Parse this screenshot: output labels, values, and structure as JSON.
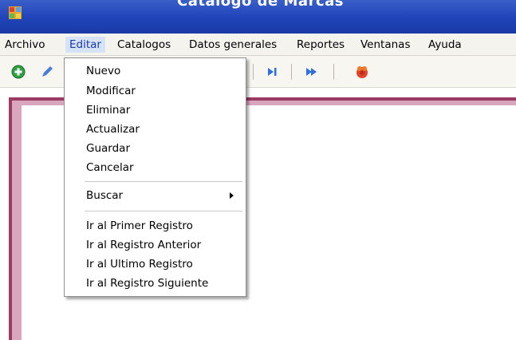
{
  "window": {
    "title": "Catalogo de Marcas"
  },
  "menubar": {
    "items": [
      {
        "label": "Archivo"
      },
      {
        "label": "Editar"
      },
      {
        "label": "Catalogos"
      },
      {
        "label": "Datos generales"
      },
      {
        "label": "Reportes"
      },
      {
        "label": "Ventanas"
      },
      {
        "label": "Ayuda"
      }
    ]
  },
  "toolbar": {
    "buttons": [
      {
        "icon": "add-icon"
      },
      {
        "icon": "edit-icon"
      },
      {
        "icon": "last-record-icon"
      },
      {
        "icon": "next-record-icon"
      },
      {
        "icon": "exit-icon"
      }
    ]
  },
  "dropdown": {
    "items": [
      {
        "label": "Nuevo"
      },
      {
        "label": "Modificar"
      },
      {
        "label": "Eliminar"
      },
      {
        "label": "Actualizar"
      },
      {
        "label": "Guardar"
      },
      {
        "label": "Cancelar"
      },
      {
        "label": "Buscar"
      },
      {
        "label": "Ir al Primer Registro"
      },
      {
        "label": "Ir al Registro Anterior"
      },
      {
        "label": "Ir al Ultimo Registro"
      },
      {
        "label": "Ir al Registro Siguiente"
      }
    ]
  },
  "colors": {
    "titlebar": "#1f43b8",
    "frame": "#9c3a61",
    "frame_inner": "#d8a7bd",
    "menu_highlight": "#d6e3f7"
  }
}
